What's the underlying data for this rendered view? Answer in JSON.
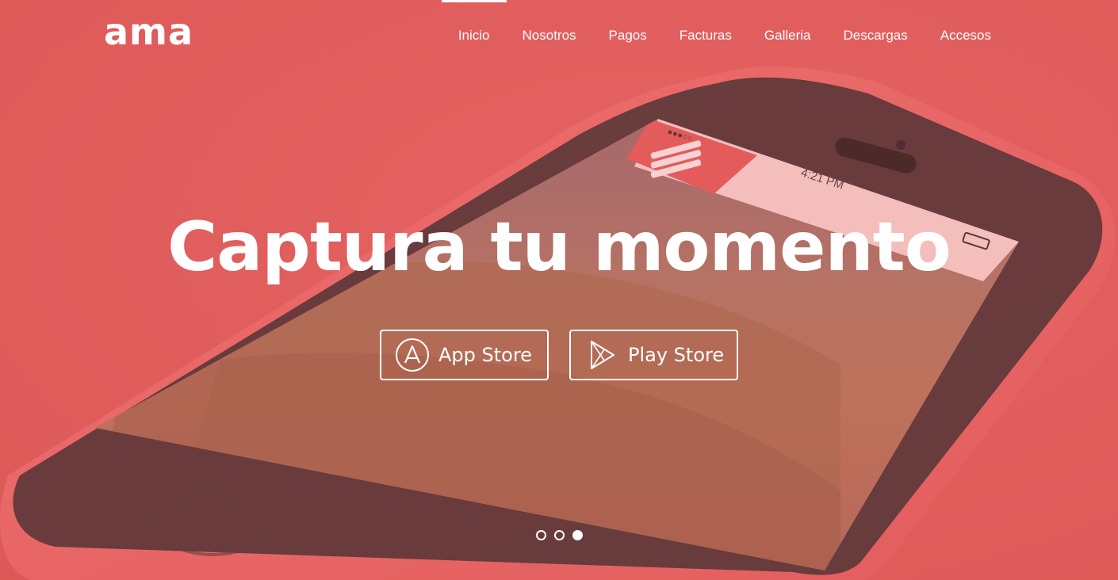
{
  "brand": {
    "logo": "ama"
  },
  "nav": {
    "items": [
      {
        "label": "Inicio",
        "active": true
      },
      {
        "label": "Nosotros",
        "active": false
      },
      {
        "label": "Pagos",
        "active": false
      },
      {
        "label": "Facturas",
        "active": false
      },
      {
        "label": "Galleria",
        "active": false
      },
      {
        "label": "Descargas",
        "active": false
      },
      {
        "label": "Accesos",
        "active": false
      }
    ]
  },
  "hero": {
    "headline": "Captura tu momento",
    "buttons": [
      {
        "label": "App Store",
        "icon": "app-store-icon"
      },
      {
        "label": "Play Store",
        "icon": "play-store-icon"
      }
    ],
    "phone_time": "4:21 PM"
  },
  "carousel": {
    "slide_count": 3,
    "active_index": 2
  },
  "colors": {
    "background": "#e05e5d",
    "text": "#ffffff",
    "phone_body": "#ef6b6a",
    "phone_bezel": "#2a2a2c"
  }
}
